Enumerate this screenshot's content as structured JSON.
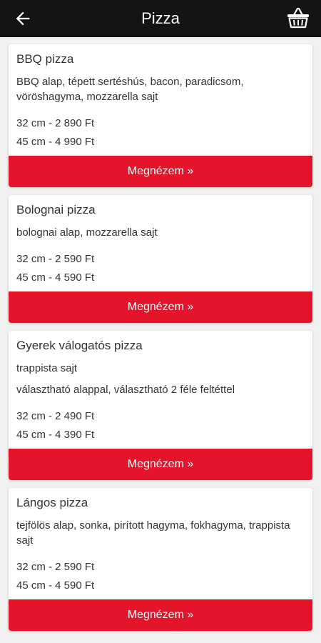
{
  "header": {
    "title": "Pizza",
    "back_icon": "arrow-left-icon",
    "cart_icon": "basket-icon"
  },
  "items": [
    {
      "name": "BBQ pizza",
      "description": "BBQ alap, tépett sertéshús, bacon, paradicsom, vöröshagyma, mozzarella sajt",
      "extra": "",
      "prices": [
        "32 cm - 2 890 Ft",
        "45 cm - 4 990 Ft"
      ],
      "button": "Megnézem »"
    },
    {
      "name": "Bolognai pizza",
      "description": "bolognai alap, mozzarella sajt",
      "extra": "",
      "prices": [
        "32 cm - 2 590 Ft",
        "45 cm - 4 590 Ft"
      ],
      "button": "Megnézem »"
    },
    {
      "name": "Gyerek válogatós pizza",
      "description": "trappista sajt",
      "extra": "választható alappal, választható 2 féle feltéttel",
      "prices": [
        "32 cm - 2 490 Ft",
        "45 cm - 4 390 Ft"
      ],
      "button": "Megnézem »"
    },
    {
      "name": "Lángos pizza",
      "description": "tejfölös alap, sonka, pirított hagyma, fokhagyma, trappista sajt",
      "extra": "",
      "prices": [
        "32 cm - 2 590 Ft",
        "45 cm - 4 590 Ft"
      ],
      "button": "Megnézem »"
    }
  ],
  "colors": {
    "header_bg": "#141414",
    "accent": "#e4152b",
    "page_bg": "#f1f1f1"
  }
}
